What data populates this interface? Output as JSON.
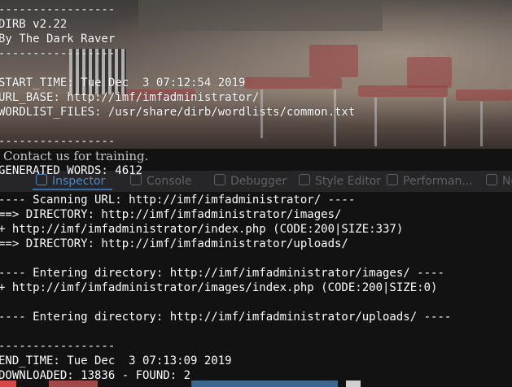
{
  "terminal": {
    "lines": [
      "-----------------",
      "DIRB v2.22",
      "By The Dark Raver",
      "-----------------",
      "",
      "START_TIME: Tue Dec  3 07:12:54 2019",
      "URL_BASE: http://imf/imfadministrator/",
      "WORDLIST_FILES: /usr/share/dirb/wordlists/common.txt",
      "",
      "-----------------",
      "",
      "GENERATED WORDS: 4612",
      "",
      "---- Scanning URL: http://imf/imfadministrator/ ----",
      "==> DIRECTORY: http://imf/imfadministrator/images/",
      "+ http://imf/imfadministrator/index.php (CODE:200|SIZE:337)",
      "==> DIRECTORY: http://imf/imfadministrator/uploads/",
      "",
      "---- Entering directory: http://imf/imfadministrator/images/ ----",
      "+ http://imf/imfadministrator/images/index.php (CODE:200|SIZE:0)",
      "",
      "---- Entering directory: http://imf/imfadministrator/uploads/ ----",
      "",
      "-----------------",
      "END_TIME: Tue Dec  3 07:13:09 2019",
      "DOWNLOADED: 13836 - FOUND: 2"
    ]
  },
  "background_page": {
    "contact_text": "Contact us for training.",
    "devtools_tabs": [
      {
        "label": "Inspector",
        "icon": "inspector-icon",
        "active": true
      },
      {
        "label": "Console",
        "icon": "console-icon",
        "active": false
      },
      {
        "label": "Debugger",
        "icon": "debugger-icon",
        "active": false
      },
      {
        "label": "Style Editor",
        "icon": "style-editor-icon",
        "active": false
      },
      {
        "label": "Performan...",
        "icon": "performance-icon",
        "active": false
      },
      {
        "label": "Ne",
        "icon": "network-icon",
        "active": false
      }
    ]
  },
  "colors": {
    "terminal_text": "#ffffff",
    "terminal_bg": "#121212",
    "devtools_active": "#5a9fe0"
  }
}
